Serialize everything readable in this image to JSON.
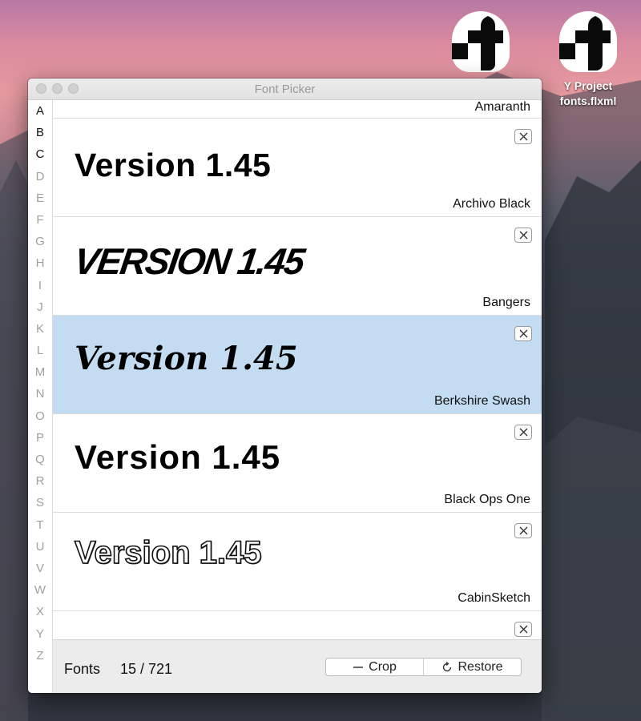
{
  "window": {
    "title": "Font Picker"
  },
  "desktop": {
    "icons": [
      {
        "label": "",
        "icon": "flxml-file-icon"
      },
      {
        "label": "Y Project\nfonts.flxml",
        "icon": "flxml-file-icon"
      }
    ]
  },
  "alphabet": [
    "A",
    "B",
    "C",
    "D",
    "E",
    "F",
    "G",
    "H",
    "I",
    "J",
    "K",
    "L",
    "M",
    "N",
    "O",
    "P",
    "Q",
    "R",
    "S",
    "T",
    "U",
    "V",
    "W",
    "X",
    "Y",
    "Z"
  ],
  "active_letters": [
    "A",
    "B",
    "C"
  ],
  "fonts": {
    "partial_top": {
      "name": "Amaranth"
    },
    "rows": [
      {
        "preview": "Version 1.45",
        "name": "Archivo Black",
        "selected": false
      },
      {
        "preview": "VERSION 1.45",
        "name": "Bangers",
        "selected": false
      },
      {
        "preview": "Version 1.45",
        "name": "Berkshire Swash",
        "selected": true
      },
      {
        "preview": "Version 1.45",
        "name": "Black Ops One",
        "selected": false
      },
      {
        "preview": "Version 1.45",
        "name": "CabinSketch",
        "selected": false
      }
    ]
  },
  "footer": {
    "label": "Fonts",
    "count": "15 / 721",
    "crop_label": "Crop",
    "restore_label": "Restore"
  },
  "colors": {
    "selected_row": "#c3dcf2",
    "window_bg": "#ffffff",
    "footer_bg": "#ececec"
  }
}
